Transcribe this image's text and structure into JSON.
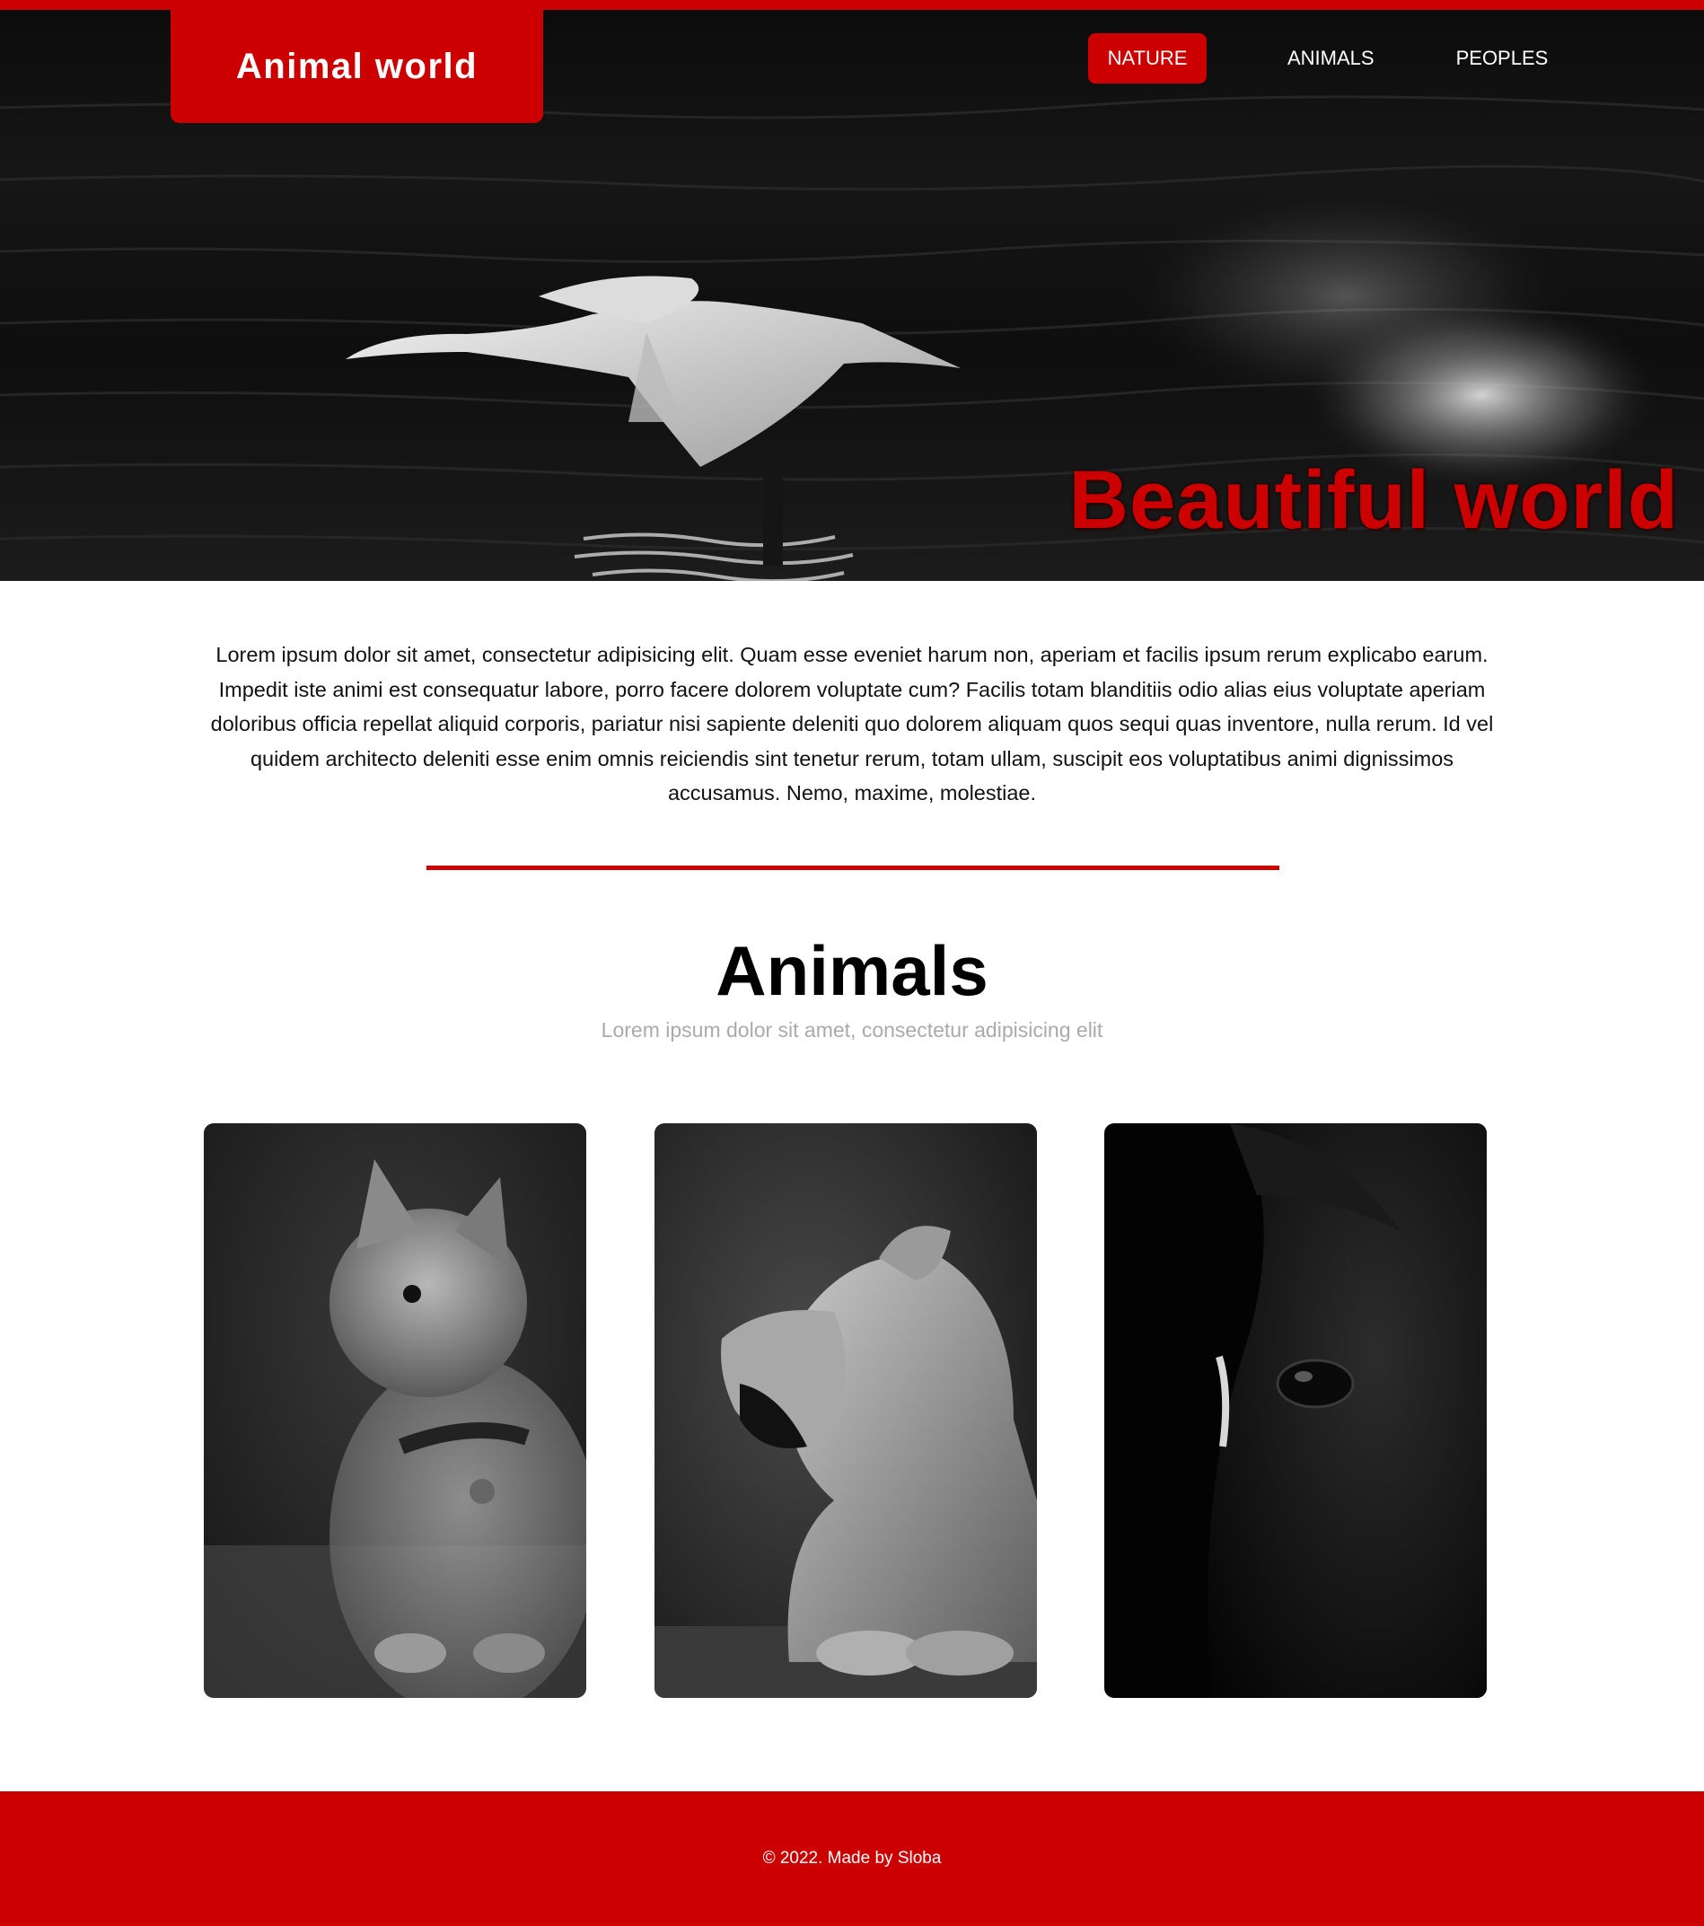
{
  "header": {
    "logo": "Animal world",
    "nav": [
      {
        "label": "NATURE",
        "active": true
      },
      {
        "label": "ANIMALS",
        "active": false
      },
      {
        "label": "PEOPLES",
        "active": false
      }
    ]
  },
  "hero": {
    "title": "Beautiful world",
    "image": "swan-flying-over-water-photo"
  },
  "intro": {
    "text": "Lorem ipsum dolor sit amet, consectetur adipisicing elit. Quam esse eveniet harum non, aperiam et facilis ipsum rerum explicabo earum. Impedit iste animi est consequatur labore, porro facere dolorem voluptate cum? Facilis totam blanditiis odio alias eius voluptate aperiam doloribus officia repellat aliquid corporis, pariatur nisi sapiente deleniti quo dolorem aliquam quos sequi quas inventore, nulla rerum. Id vel quidem architecto deleniti esse enim omnis reiciendis sint tenetur rerum, totam ullam, suscipit eos voluptatibus animi dignissimos accusamus. Nemo, maxime, molestiae."
  },
  "animals": {
    "title": "Animals",
    "subtitle": "Lorem ipsum dolor sit amet, consectetur adipisicing elit",
    "cards": [
      {
        "image": "kitten-photo"
      },
      {
        "image": "lioness-roaring-photo"
      },
      {
        "image": "horse-eye-closeup-photo"
      }
    ]
  },
  "footer": {
    "text": "© 2022. Made by Sloba"
  },
  "colors": {
    "accent": "#cc0000",
    "text": "#111111",
    "muted": "#aaaaaa",
    "background": "#ffffff"
  }
}
